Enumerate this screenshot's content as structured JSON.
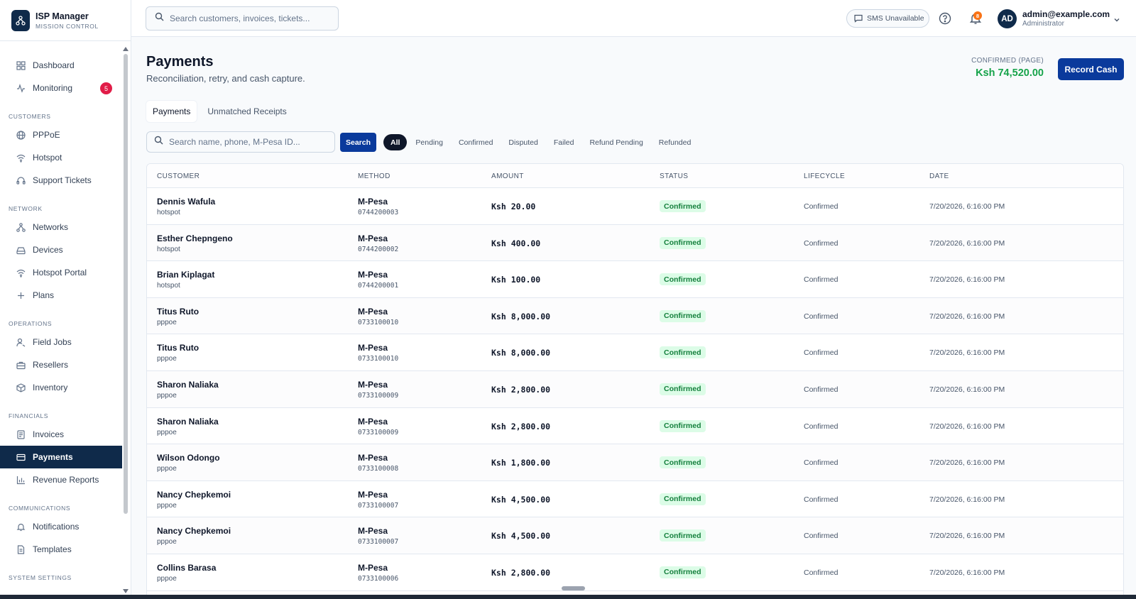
{
  "brand": {
    "title": "ISP Manager",
    "subtitle": "MISSION CONTROL"
  },
  "sidebar": {
    "top_items": [
      {
        "label": "Dashboard",
        "icon": "grid-icon"
      },
      {
        "label": "Monitoring",
        "icon": "activity-icon",
        "badge": "5"
      }
    ],
    "sections": [
      {
        "title": "CUSTOMERS",
        "items": [
          {
            "label": "PPPoE",
            "icon": "globe-icon"
          },
          {
            "label": "Hotspot",
            "icon": "wifi-icon"
          },
          {
            "label": "Support Tickets",
            "icon": "headset-icon"
          }
        ]
      },
      {
        "title": "NETWORK",
        "items": [
          {
            "label": "Networks",
            "icon": "network-icon"
          },
          {
            "label": "Devices",
            "icon": "hard-drive-icon"
          },
          {
            "label": "Hotspot Portal",
            "icon": "wifi-icon"
          },
          {
            "label": "Plans",
            "icon": "plus-icon"
          }
        ]
      },
      {
        "title": "OPERATIONS",
        "items": [
          {
            "label": "Field Jobs",
            "icon": "user-wrench-icon"
          },
          {
            "label": "Resellers",
            "icon": "briefcase-icon"
          },
          {
            "label": "Inventory",
            "icon": "package-icon"
          }
        ]
      },
      {
        "title": "FINANCIALS",
        "items": [
          {
            "label": "Invoices",
            "icon": "receipt-icon"
          },
          {
            "label": "Payments",
            "icon": "credit-card-icon",
            "active": true
          },
          {
            "label": "Revenue Reports",
            "icon": "bar-chart-icon"
          }
        ]
      },
      {
        "title": "COMMUNICATIONS",
        "items": [
          {
            "label": "Notifications",
            "icon": "bell-icon"
          },
          {
            "label": "Templates",
            "icon": "file-text-icon"
          }
        ]
      },
      {
        "title": "SYSTEM SETTINGS",
        "items": []
      }
    ]
  },
  "header": {
    "search_placeholder": "Search customers, invoices, tickets...",
    "sms_label": "SMS",
    "sms_status": "Unavailable",
    "notification_count": "8",
    "user": {
      "initials": "AD",
      "email": "admin@example.com",
      "role": "Administrator"
    }
  },
  "page": {
    "title": "Payments",
    "subtitle": "Reconciliation, retry, and cash capture.",
    "kpi_label": "CONFIRMED (PAGE)",
    "kpi_value": "Ksh 74,520.00",
    "record_button": "Record Cash",
    "tabs": [
      {
        "label": "Payments",
        "active": true
      },
      {
        "label": "Unmatched Receipts",
        "active": false
      }
    ],
    "table_search_placeholder": "Search name, phone, M-Pesa ID...",
    "search_button": "Search",
    "filters": [
      {
        "label": "All",
        "active": true
      },
      {
        "label": "Pending"
      },
      {
        "label": "Confirmed"
      },
      {
        "label": "Disputed"
      },
      {
        "label": "Failed"
      },
      {
        "label": "Refund Pending"
      },
      {
        "label": "Refunded"
      }
    ]
  },
  "table": {
    "columns": [
      "CUSTOMER",
      "METHOD",
      "AMOUNT",
      "STATUS",
      "LIFECYCLE",
      "DATE"
    ],
    "rows": [
      {
        "name": "Dennis Wafula",
        "type": "hotspot",
        "method": "M-Pesa",
        "phone": "0744200003",
        "amount": "Ksh 20.00",
        "status": "Confirmed",
        "lifecycle": "Confirmed",
        "date": "7/20/2026, 6:16:00 PM"
      },
      {
        "name": "Esther Chepngeno",
        "type": "hotspot",
        "method": "M-Pesa",
        "phone": "0744200002",
        "amount": "Ksh 400.00",
        "status": "Confirmed",
        "lifecycle": "Confirmed",
        "date": "7/20/2026, 6:16:00 PM"
      },
      {
        "name": "Brian Kiplagat",
        "type": "hotspot",
        "method": "M-Pesa",
        "phone": "0744200001",
        "amount": "Ksh 100.00",
        "status": "Confirmed",
        "lifecycle": "Confirmed",
        "date": "7/20/2026, 6:16:00 PM"
      },
      {
        "name": "Titus Ruto",
        "type": "pppoe",
        "method": "M-Pesa",
        "phone": "0733100010",
        "amount": "Ksh 8,000.00",
        "status": "Confirmed",
        "lifecycle": "Confirmed",
        "date": "7/20/2026, 6:16:00 PM"
      },
      {
        "name": "Titus Ruto",
        "type": "pppoe",
        "method": "M-Pesa",
        "phone": "0733100010",
        "amount": "Ksh 8,000.00",
        "status": "Confirmed",
        "lifecycle": "Confirmed",
        "date": "7/20/2026, 6:16:00 PM"
      },
      {
        "name": "Sharon Naliaka",
        "type": "pppoe",
        "method": "M-Pesa",
        "phone": "0733100009",
        "amount": "Ksh 2,800.00",
        "status": "Confirmed",
        "lifecycle": "Confirmed",
        "date": "7/20/2026, 6:16:00 PM"
      },
      {
        "name": "Sharon Naliaka",
        "type": "pppoe",
        "method": "M-Pesa",
        "phone": "0733100009",
        "amount": "Ksh 2,800.00",
        "status": "Confirmed",
        "lifecycle": "Confirmed",
        "date": "7/20/2026, 6:16:00 PM"
      },
      {
        "name": "Wilson Odongo",
        "type": "pppoe",
        "method": "M-Pesa",
        "phone": "0733100008",
        "amount": "Ksh 1,800.00",
        "status": "Confirmed",
        "lifecycle": "Confirmed",
        "date": "7/20/2026, 6:16:00 PM"
      },
      {
        "name": "Nancy Chepkemoi",
        "type": "pppoe",
        "method": "M-Pesa",
        "phone": "0733100007",
        "amount": "Ksh 4,500.00",
        "status": "Confirmed",
        "lifecycle": "Confirmed",
        "date": "7/20/2026, 6:16:00 PM"
      },
      {
        "name": "Nancy Chepkemoi",
        "type": "pppoe",
        "method": "M-Pesa",
        "phone": "0733100007",
        "amount": "Ksh 4,500.00",
        "status": "Confirmed",
        "lifecycle": "Confirmed",
        "date": "7/20/2026, 6:16:00 PM"
      },
      {
        "name": "Collins Barasa",
        "type": "pppoe",
        "method": "M-Pesa",
        "phone": "0733100006",
        "amount": "Ksh 2,800.00",
        "status": "Confirmed",
        "lifecycle": "Confirmed",
        "date": "7/20/2026, 6:16:00 PM"
      }
    ]
  },
  "colors": {
    "primary": "#0a3a9c",
    "sidebar_active": "#0f2a4a",
    "success": "#16a34a",
    "danger": "#e11d48",
    "warning": "#f97316"
  }
}
